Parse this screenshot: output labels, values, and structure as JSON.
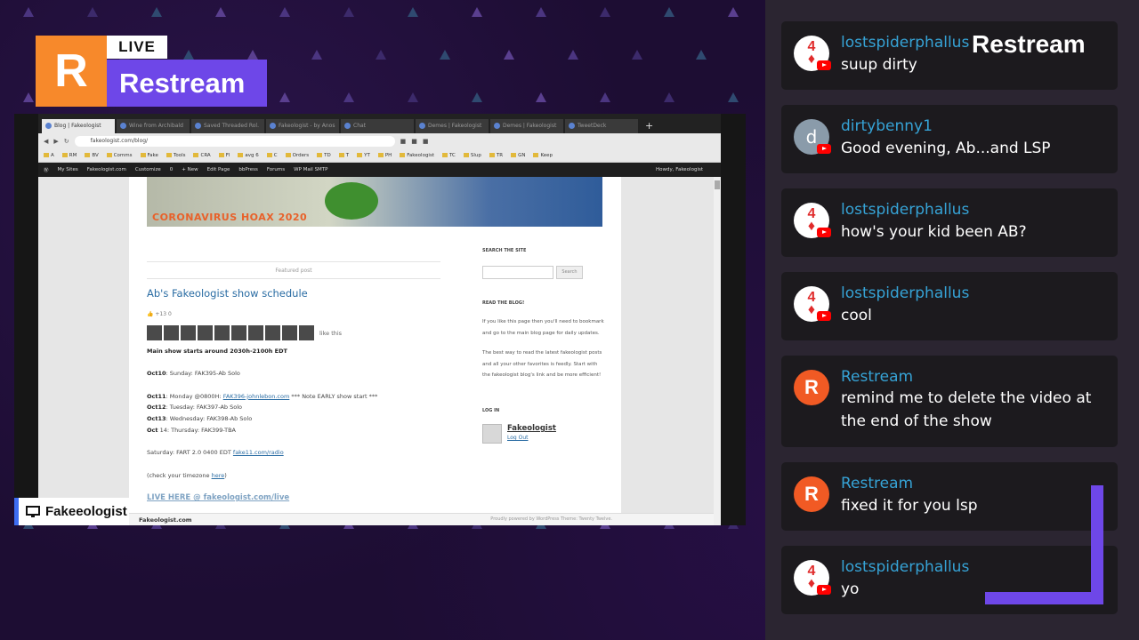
{
  "logo": {
    "initial": "R",
    "live": "LIVE",
    "brand": "Restream"
  },
  "watermark": "Restream",
  "source_tag": {
    "name": "Fakeeologist"
  },
  "browser": {
    "tabs": [
      "Blog | Fakeologist",
      "Wine from Archibald",
      "Saved Threaded Rol.",
      "Fakeologist - by Anos",
      "Chat",
      "Demes | Fakeologist",
      "Demes | Fakeologist",
      "TweetDeck"
    ],
    "url": "fakeologist.com/blog/",
    "bookmarks": [
      "A",
      "RM",
      "BV",
      "Comms",
      "Fake",
      "Tools",
      "CRA",
      "Fl",
      "avg 6",
      "C",
      "Orders",
      "TD",
      "T",
      "YT",
      "PH",
      "Fakeologist",
      "TC",
      "Slup",
      "TR",
      "GN",
      "Keep"
    ],
    "wpbar": [
      "My Sites",
      "Fakeologist.com",
      "Customize",
      "0",
      "+ New",
      "Edit Page",
      "bbPress",
      "Forums",
      "WP Mail SMTP"
    ],
    "wp_howdy": "Howdy, Fakeologist",
    "banner_text": "CORONAVIRUS HOAX 2020",
    "featured": "Featured post",
    "post_title": "Ab's Fakeologist show schedule",
    "likes": "+13  0",
    "like_this": "like this",
    "main_show": "Main show starts around 2030h-2100h EDT",
    "oct10_label": "Oct10",
    "oct10_text": ": Sunday: FAK395-Ab Solo",
    "oct11_label": "Oct11",
    "oct11_text": ": Monday @0800H: ",
    "oct11_link": "FAK396-johnlebon.com",
    "oct11_note": " *** Note EARLY show start ***",
    "oct12_label": "Oct12",
    "oct12_text": ": Tuesday: FAK397-Ab Solo",
    "oct13_label": "Oct13",
    "oct13_text": ": Wednesday: FAK398-Ab Solo",
    "oct14_label": "Oct",
    "oct14_text": " 14: Thursday: FAK399-TBA",
    "saturday_text": "Saturday: FART 2.0 0400 EDT ",
    "saturday_link": "fake11.com/radio",
    "check_tz": "(check your timezone ",
    "check_tz_link": "here",
    "check_tz_end": ")",
    "live_here": "LIVE HERE @ fakeologist.com/live",
    "sidebar": {
      "search_heading": "SEARCH THE SITE",
      "search_button": "Search",
      "read_heading": "READ THE BLOG!",
      "read_p1": "If you like this page then you'll need to bookmark and go to the main blog page for daily updates.",
      "read_p2": "The best way to read the latest fakeologist posts and all your other favorites is feedly. Start with the fakeologist blog's link and be more efficient!",
      "login_heading": "LOG IN",
      "user": "Fakeologist",
      "logout": "Log Out"
    },
    "footer_left": "Fakeologist.com",
    "footer_right": "Proudly powered by WordPress  Theme: Twenty Twelve."
  },
  "chat": [
    {
      "author": "lostspiderphallus",
      "text": "suup dirty",
      "avatar": "card",
      "avatar_text": "4"
    },
    {
      "author": "dirtybenny1",
      "text": "Good evening, Ab...and LSP",
      "avatar": "letter",
      "avatar_text": "d"
    },
    {
      "author": "lostspiderphallus",
      "text": "how's your kid been AB?",
      "avatar": "card",
      "avatar_text": "4"
    },
    {
      "author": "lostspiderphallus",
      "text": "cool",
      "avatar": "card",
      "avatar_text": "4"
    },
    {
      "author": "Restream",
      "text": "remind me to delete the video at the end of the show",
      "avatar": "restream",
      "avatar_text": "R"
    },
    {
      "author": "Restream",
      "text": "fixed it for you lsp",
      "avatar": "restream",
      "avatar_text": "R"
    },
    {
      "author": "lostspiderphallus",
      "text": "yo",
      "avatar": "card",
      "avatar_text": "4"
    }
  ],
  "colors": {
    "accent": "#6e47e8",
    "orange": "#f7892b",
    "author": "#36a3d6",
    "youtube": "#ff0000"
  }
}
